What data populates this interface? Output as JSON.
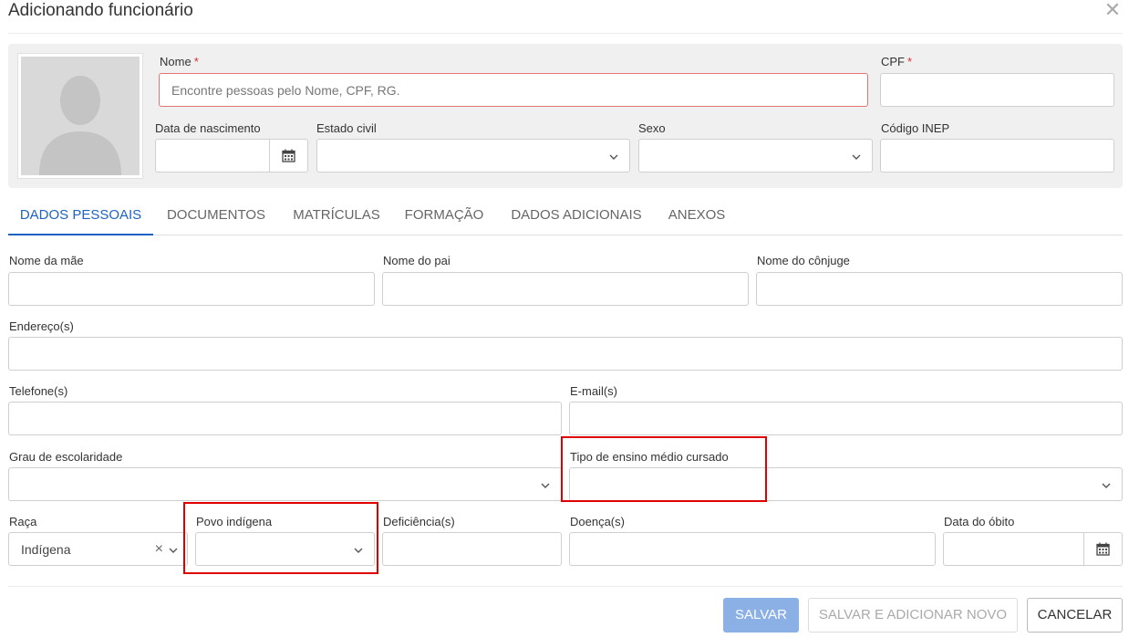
{
  "dialog": {
    "title": "Adicionando funcionário",
    "close_icon": "close-icon"
  },
  "header_fields": {
    "nome": {
      "label": "Nome",
      "required": "*",
      "placeholder": "Encontre pessoas pelo Nome, CPF, RG.",
      "value": ""
    },
    "cpf": {
      "label": "CPF",
      "required": "*",
      "value": ""
    },
    "data_nascimento": {
      "label": "Data de nascimento",
      "value": "",
      "icon": "calendar-icon"
    },
    "estado_civil": {
      "label": "Estado civil",
      "value": ""
    },
    "sexo": {
      "label": "Sexo",
      "value": ""
    },
    "codigo_inep": {
      "label": "Código INEP",
      "value": ""
    }
  },
  "tabs": [
    {
      "label": "DADOS PESSOAIS",
      "active": true
    },
    {
      "label": "DOCUMENTOS",
      "active": false
    },
    {
      "label": "MATRÍCULAS",
      "active": false
    },
    {
      "label": "FORMAÇÃO",
      "active": false
    },
    {
      "label": "DADOS ADICIONAIS",
      "active": false
    },
    {
      "label": "ANEXOS",
      "active": false
    }
  ],
  "form": {
    "nome_mae": {
      "label": "Nome da mãe",
      "value": ""
    },
    "nome_pai": {
      "label": "Nome do pai",
      "value": ""
    },
    "nome_conjuge": {
      "label": "Nome do cônjuge",
      "value": ""
    },
    "enderecos": {
      "label": "Endereço(s)",
      "value": ""
    },
    "telefones": {
      "label": "Telefone(s)",
      "value": ""
    },
    "emails": {
      "label": "E-mail(s)",
      "value": ""
    },
    "grau_escolaridade": {
      "label": "Grau de escolaridade",
      "value": ""
    },
    "tipo_ensino_medio": {
      "label": "Tipo de ensino médio cursado",
      "value": ""
    },
    "raca": {
      "label": "Raça",
      "value": "Indígena",
      "clear": "×"
    },
    "povo_indigena": {
      "label": "Povo indígena",
      "value": ""
    },
    "deficiencias": {
      "label": "Deficiência(s)",
      "value": ""
    },
    "doencas": {
      "label": "Doença(s)",
      "value": ""
    },
    "data_obito": {
      "label": "Data do óbito",
      "value": ""
    }
  },
  "footer": {
    "save_label": "SALVAR",
    "save_new_label": "SALVAR E ADICIONAR NOVO",
    "cancel_label": "CANCELAR"
  },
  "colors": {
    "accent": "#1e63c3",
    "highlight": "#e00000",
    "required": "#d32f2f",
    "save_button": "#8ab0e6"
  }
}
